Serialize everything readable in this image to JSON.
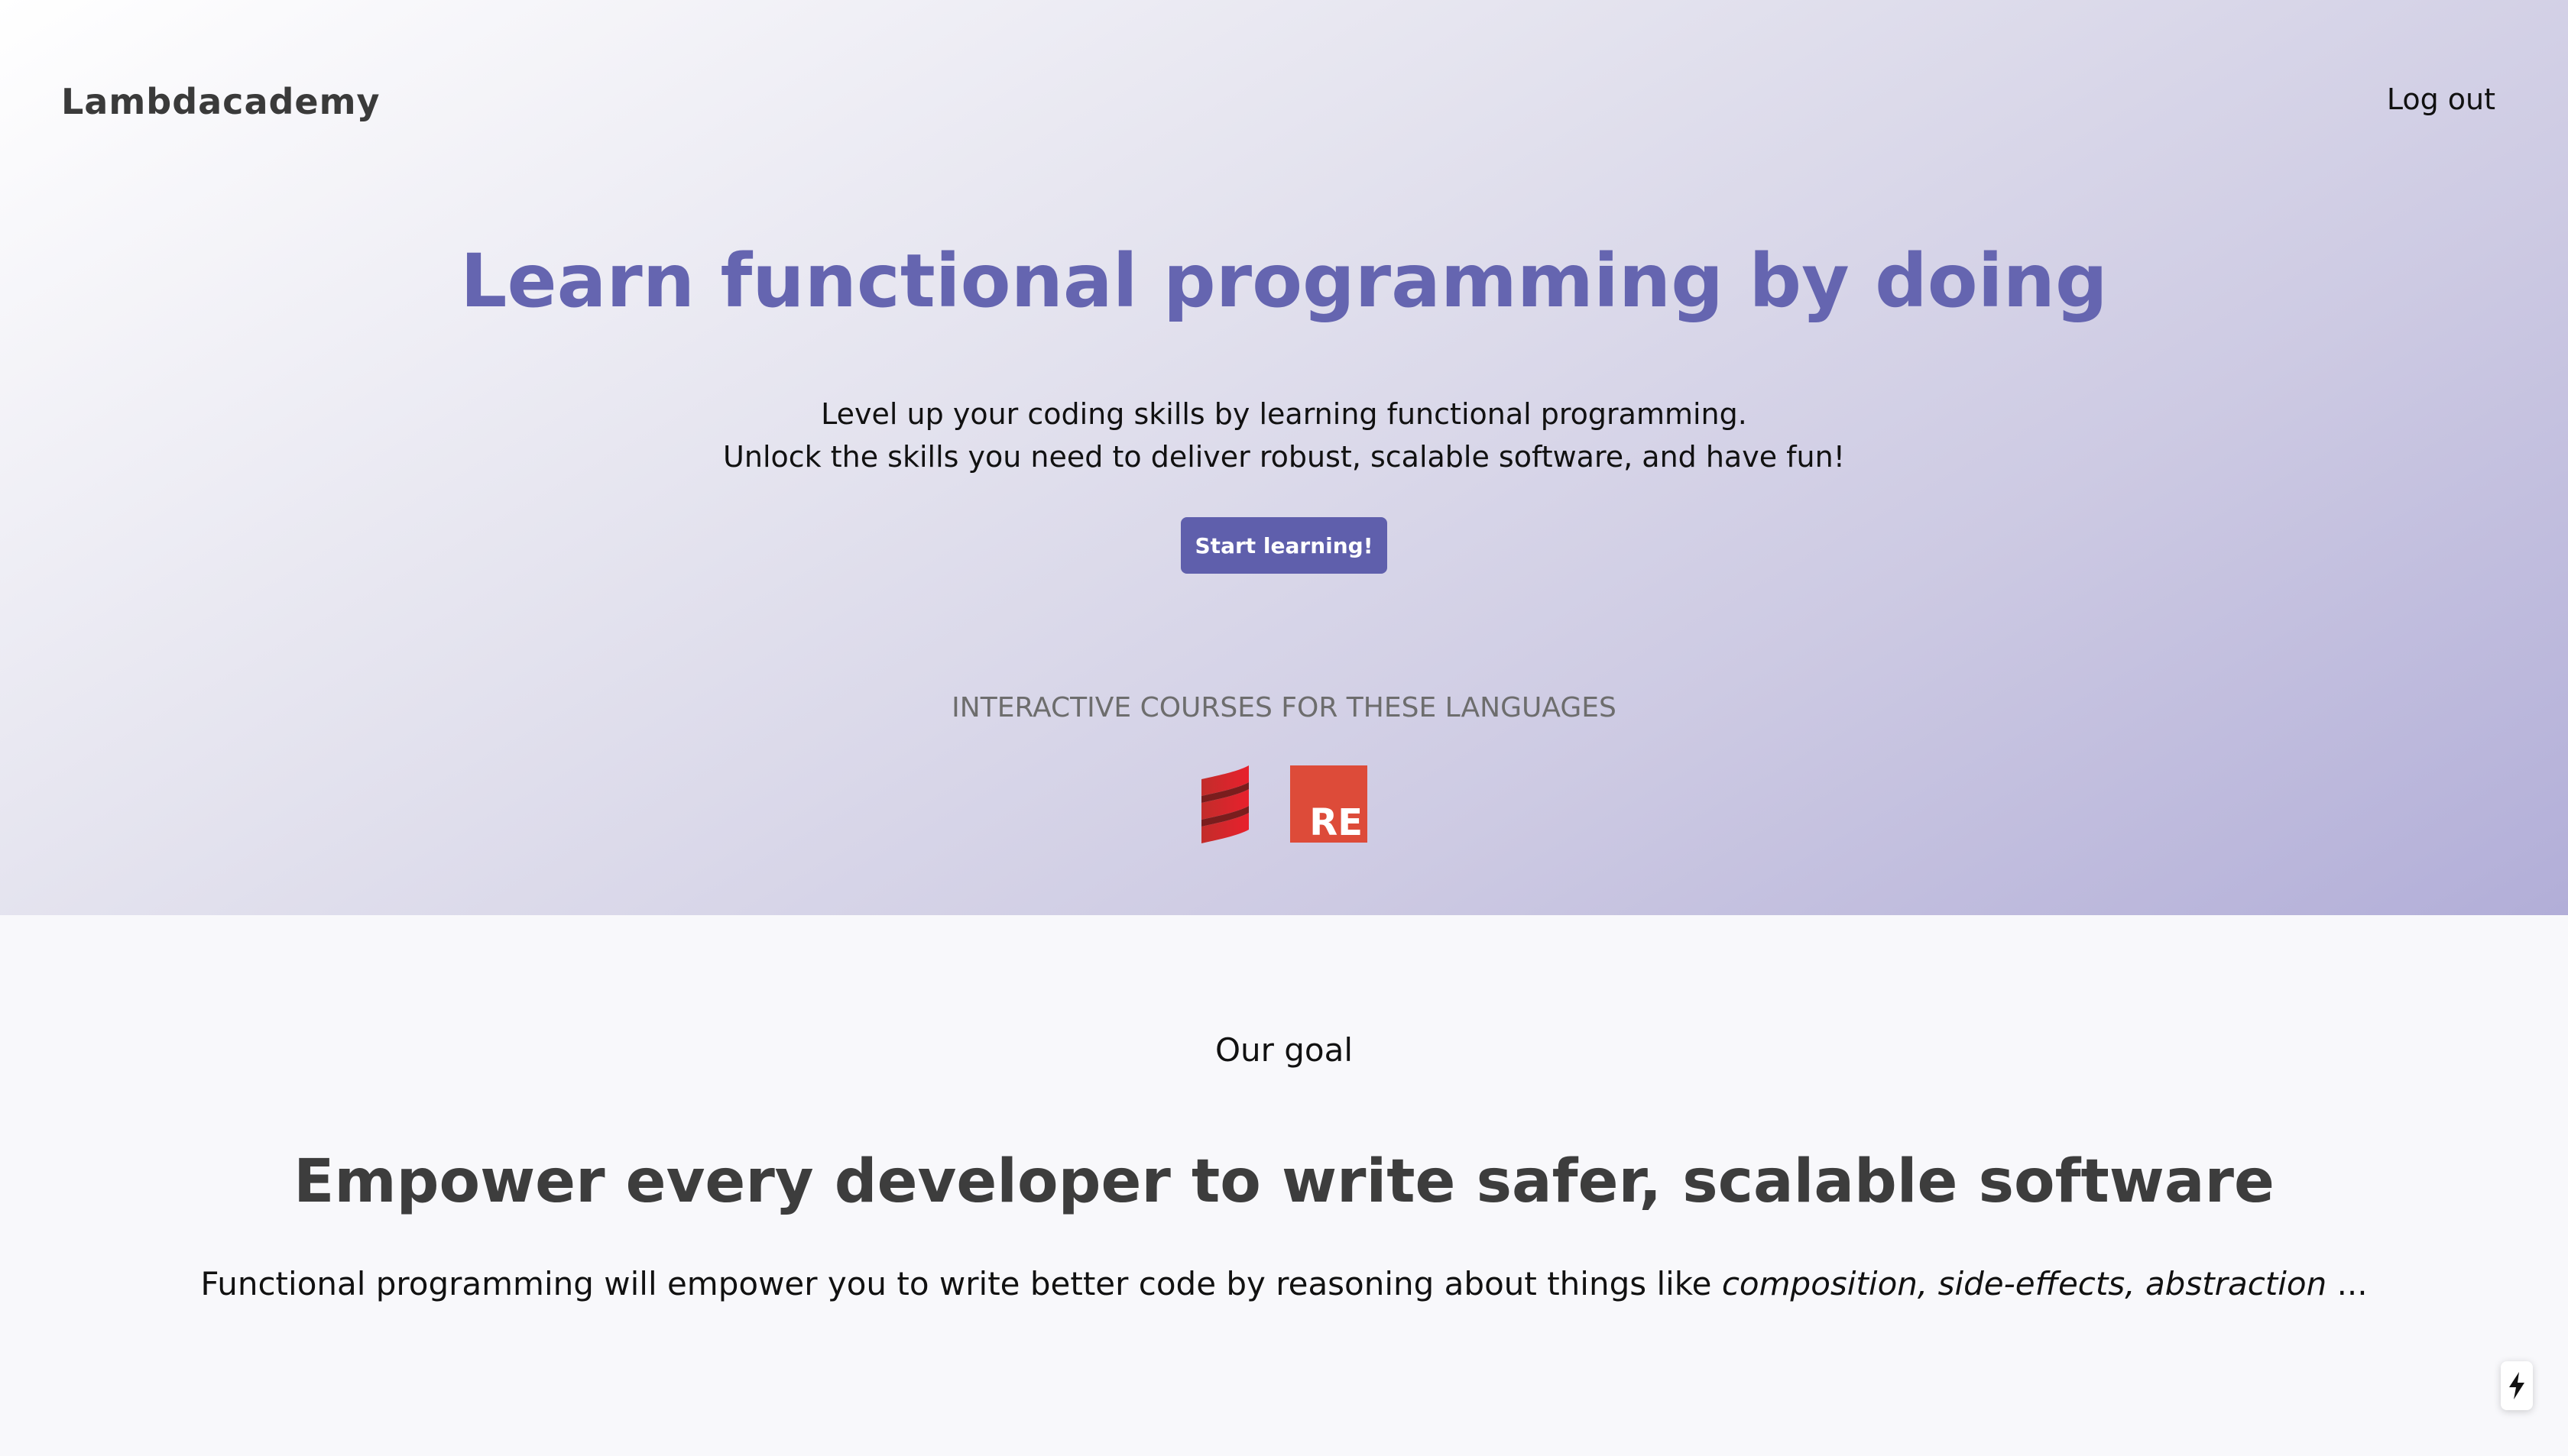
{
  "header": {
    "brand": "Lambdacademy",
    "logout_label": "Log out"
  },
  "hero": {
    "title": "Learn functional programming by doing",
    "subtitle_line1": "Level up your coding skills by learning functional programming.",
    "subtitle_line2": "Unlock the skills you need to deliver robust, scalable software, and have fun!",
    "cta_label": "Start learning!",
    "languages_caption": "INTERACTIVE COURSES FOR THESE LANGUAGES",
    "languages": [
      {
        "name": "Scala",
        "icon": "scala-logo-icon"
      },
      {
        "name": "ReasonML",
        "icon": "reason-logo-icon",
        "badge_text": "RE"
      }
    ]
  },
  "goal": {
    "label": "Our goal",
    "title": "Empower every developer to write safer, scalable software",
    "text_prefix": "Functional programming will empower you to write better code by reasoning about things like ",
    "term1": "composition",
    "sep1": ", ",
    "term2": "side-effects",
    "sep2": ", ",
    "term3": "abstraction",
    "text_suffix": " ..."
  },
  "corner_widget": {
    "icon": "lightning-bolt-icon"
  },
  "colors": {
    "brand_purple": "#6565b0",
    "button_bg": "#5f5fac",
    "reason_red": "#dd4b39",
    "scala_red": "#de3423"
  }
}
